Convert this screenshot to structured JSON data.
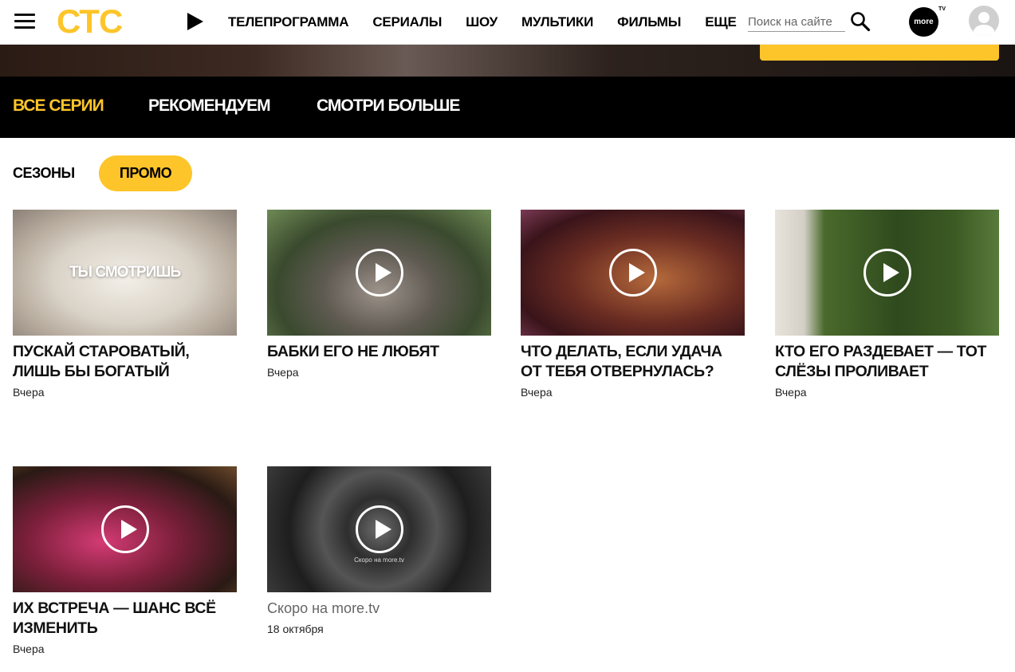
{
  "header": {
    "logo": "СТС",
    "nav": [
      "ТЕЛЕПРОГРАММА",
      "СЕРИАЛЫ",
      "ШОУ",
      "МУЛЬТИКИ",
      "ФИЛЬМЫ",
      "ЕЩЕ"
    ],
    "search_placeholder": "Поиск на сайте",
    "partner_logo": "more",
    "partner_logo_sup": "TV"
  },
  "tabs": [
    "ВСЕ СЕРИИ",
    "РЕКОМЕНДУЕМ",
    "СМОТРИ БОЛЬШЕ"
  ],
  "filters": {
    "seasons": "СЕЗОНЫ",
    "promo": "ПРОМО"
  },
  "cards": [
    {
      "title": "ПУСКАЙ СТАРОВАТЫЙ, ЛИШЬ БЫ БОГАТЫЙ",
      "date": "Вчера",
      "overlay": "ТЫ СМОТРИШЬ"
    },
    {
      "title": "БАБКИ ЕГО НЕ ЛЮБЯТ",
      "date": "Вчера"
    },
    {
      "title": "ЧТО ДЕЛАТЬ, ЕСЛИ УДАЧА ОТ ТЕБЯ ОТВЕРНУЛАСЬ?",
      "date": "Вчера"
    },
    {
      "title": "КТО ЕГО РАЗДЕВАЕТ — ТОТ СЛЁЗЫ ПРОЛИВАЕТ",
      "date": "Вчера"
    },
    {
      "title": "ИХ ВСТРЕЧА — ШАНС ВСЁ ИЗМЕНИТЬ",
      "date": "Вчера"
    },
    {
      "title": "Скоро на more.tv",
      "date": "18 октября",
      "thumb_caption": "Скоро на more.tv"
    }
  ],
  "colors": {
    "accent": "#fdc52a",
    "band": "#000000"
  }
}
